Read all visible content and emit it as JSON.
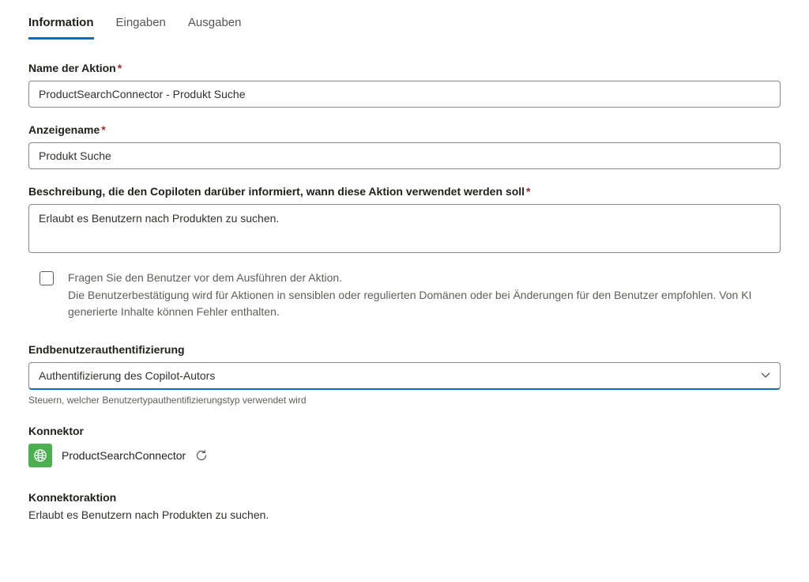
{
  "tabs": {
    "information": "Information",
    "inputs": "Eingaben",
    "outputs": "Ausgaben"
  },
  "fields": {
    "action_name": {
      "label": "Name der Aktion",
      "value": "ProductSearchConnector - Produkt Suche"
    },
    "display_name": {
      "label": "Anzeigename",
      "value": "Produkt Suche"
    },
    "description": {
      "label": "Beschreibung, die den Copiloten darüber informiert, wann diese Aktion verwendet werden soll",
      "value": "Erlaubt es Benutzern nach Produkten zu suchen."
    },
    "confirm_checkbox": {
      "line1": "Fragen Sie den Benutzer vor dem Ausführen der Aktion.",
      "line2": "Die Benutzerbestätigung wird für Aktionen in sensiblen oder regulierten Domänen oder bei Änderungen für den Benutzer empfohlen. Von KI generierte Inhalte können Fehler enthalten."
    },
    "auth": {
      "label": "Endbenutzerauthentifizierung",
      "value": "Authentifizierung des Copilot-Autors",
      "helper": "Steuern, welcher Benutzertypauthentifizierungstyp verwendet wird"
    },
    "connector": {
      "label": "Konnektor",
      "name": "ProductSearchConnector"
    },
    "connector_action": {
      "label": "Konnektoraktion",
      "text": "Erlaubt es Benutzern nach Produkten zu suchen."
    }
  }
}
